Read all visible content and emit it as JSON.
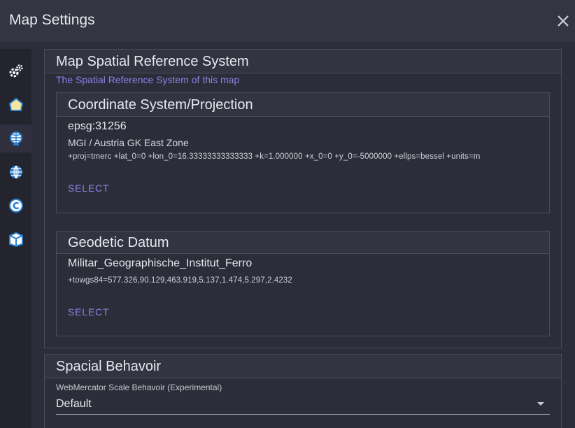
{
  "dialog": {
    "title": "Map Settings"
  },
  "sidebar": {
    "items": [
      {
        "icon": "gears-icon"
      },
      {
        "icon": "map-pin-icon"
      },
      {
        "icon": "globe-grid-icon"
      },
      {
        "icon": "globe-icon"
      },
      {
        "icon": "copyright-icon"
      },
      {
        "icon": "package-icon"
      }
    ]
  },
  "srs": {
    "heading": "Map Spatial Reference System",
    "subtitle": "The Spatial Reference System of this map",
    "projection": {
      "heading": "Coordinate System/Projection",
      "code": "epsg:31256",
      "name": "MGI / Austria GK East Zone",
      "proj4": "+proj=tmerc +lat_0=0 +lon_0=16.33333333333333 +k=1.000000 +x_0=0 +y_0=-5000000 +ellps=bessel +units=m",
      "select_label": "SELECT"
    },
    "datum": {
      "heading": "Geodetic Datum",
      "name": "Militar_Geographische_Institut_Ferro",
      "towgs": "+towgs84=577.326,90.129,463.919,5.137,1.474,5.297,2.4232",
      "select_label": "SELECT"
    }
  },
  "behaviour": {
    "heading": "Spacial Behavoir",
    "field_label": "WebMercator Scale Behavoir (Experimental)",
    "value": "Default"
  }
}
